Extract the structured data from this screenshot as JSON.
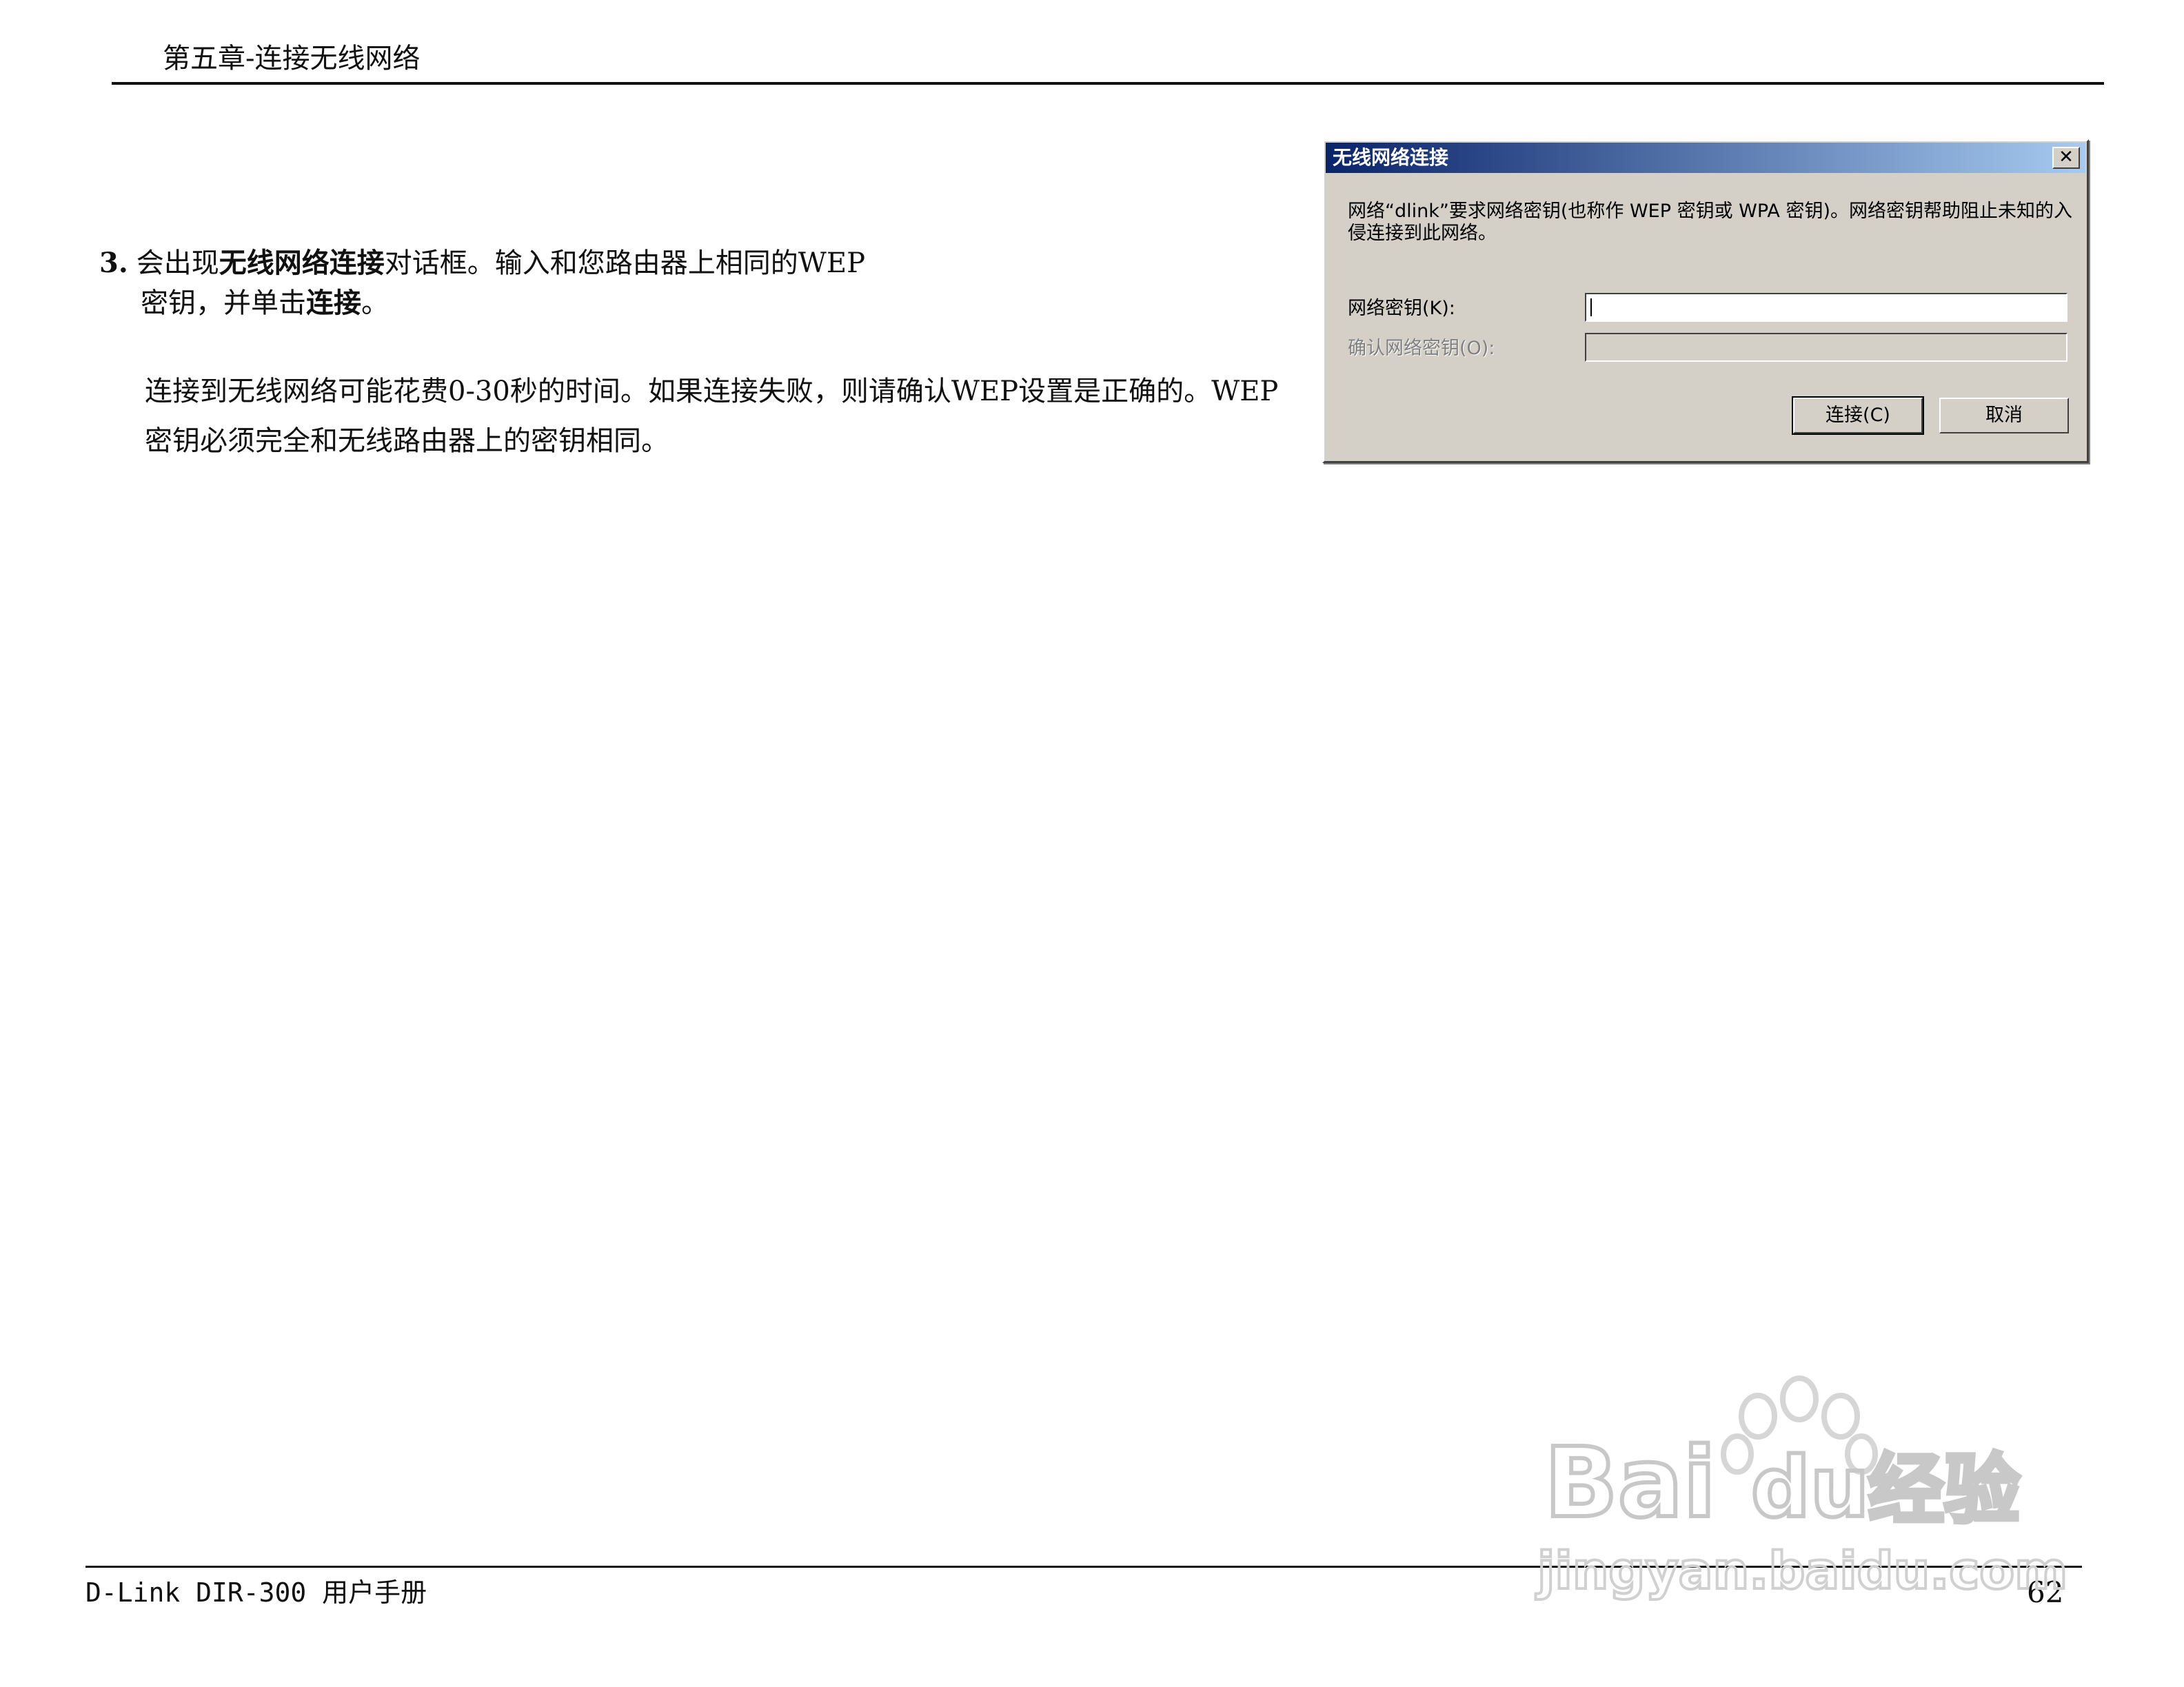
{
  "header": {
    "chapter_title": "第五章-连接无线网络"
  },
  "step": {
    "number": "3.",
    "text_1": "会出现",
    "bold_1": "无线网络连接",
    "text_2": "对话框。输入和您路由器上相同的WEP",
    "text_3": "密钥，并单击",
    "bold_2": "连接",
    "text_4": "。"
  },
  "note": "连接到无线网络可能花费0-30秒的时间。如果连接失败，则请确认WEP设置是正确的。WEP密钥必须完全和无线路由器上的密钥相同。",
  "dialog": {
    "title": "无线网络连接",
    "close_glyph": "✕",
    "message": "网络“dlink”要求网络密钥(也称作 WEP 密钥或 WPA 密钥)。网络密钥帮助阻止未知的入侵连接到此网络。",
    "key_label": "网络密钥(K):",
    "confirm_label": "确认网络密钥(O):",
    "connect_button": "连接(C)",
    "cancel_button": "取消"
  },
  "footer": {
    "manual": "D-Link DIR-300 用户手册",
    "page": "62"
  },
  "watermark": {
    "brand": "Bai",
    "brand2": "du",
    "suffix": "经验",
    "url": "jingyan.baidu.com"
  },
  "colors": {
    "titlebar_start": "#0a246a",
    "titlebar_end": "#a6caf0",
    "dialog_bg": "#d4d0c8"
  }
}
